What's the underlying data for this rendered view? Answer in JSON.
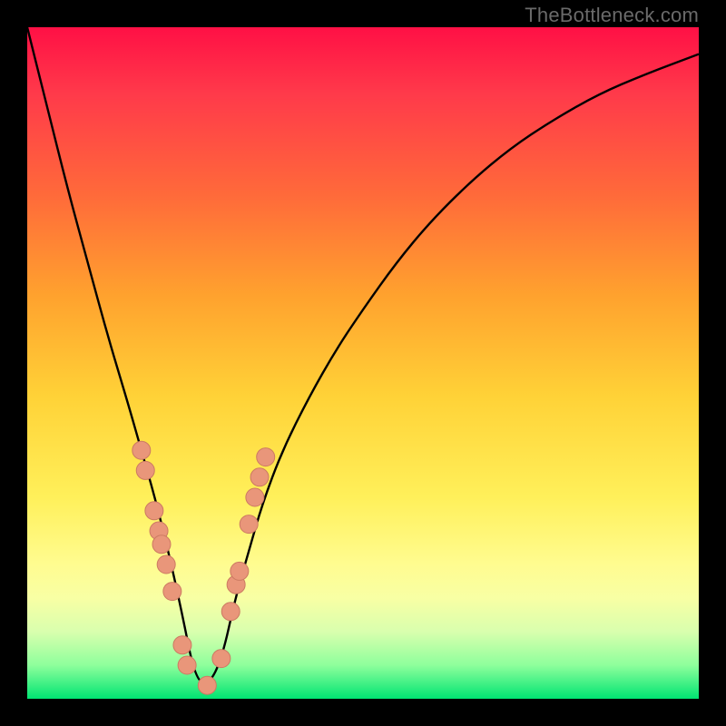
{
  "watermark": "TheBottleneck.com",
  "colors": {
    "frame": "#000000",
    "curve": "#000000",
    "dot_fill": "#e9967a",
    "dot_stroke": "#cc7a62",
    "gradient_top": "#ff1045",
    "gradient_bottom": "#00e472"
  },
  "chart_data": {
    "type": "line",
    "title": "",
    "xlabel": "",
    "ylabel": "",
    "xlim": [
      0,
      100
    ],
    "ylim": [
      0,
      100
    ],
    "note": "x is a normalized horizontal position; y is the bottleneck percentage. Minimum (0%) occurs near x≈26.",
    "series": [
      {
        "name": "bottleneck-curve",
        "x": [
          0,
          3,
          6,
          9,
          12,
          15,
          17,
          19,
          21,
          23,
          25,
          27,
          29,
          31,
          33,
          35,
          38,
          42,
          46,
          50,
          55,
          60,
          66,
          72,
          78,
          85,
          92,
          100
        ],
        "y": [
          100,
          88,
          76,
          65,
          54,
          44,
          37,
          30,
          22,
          13,
          3,
          2,
          6,
          15,
          22,
          29,
          37,
          45,
          52,
          58,
          65,
          71,
          77,
          82,
          86,
          90,
          93,
          96
        ]
      }
    ],
    "annotations": {
      "dots_x": [
        17.0,
        17.6,
        18.9,
        19.6,
        20.0,
        20.7,
        21.6,
        23.1,
        23.8,
        26.8,
        28.9,
        30.3,
        31.1,
        31.6,
        33.0,
        33.9,
        34.6,
        35.5
      ],
      "dots_y": [
        37,
        34,
        28,
        25,
        23,
        20,
        16,
        8,
        5,
        2,
        6,
        13,
        17,
        19,
        26,
        30,
        33,
        36
      ],
      "dot_radius_px": 10
    }
  }
}
